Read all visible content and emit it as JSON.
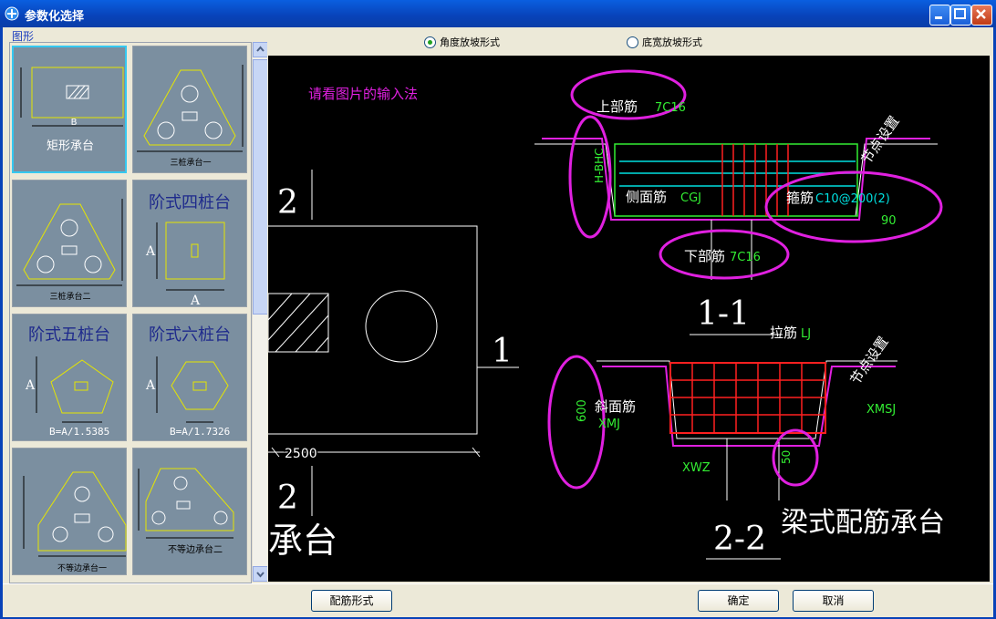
{
  "window": {
    "title": "参数化选择"
  },
  "left": {
    "group_label": "图形",
    "thumbnails": [
      {
        "label": "矩形承台",
        "dim": "B"
      },
      {
        "label": "三桩承台一"
      },
      {
        "label": "三桩承台二"
      },
      {
        "label": "阶式四桩台",
        "dim_a": "A",
        "dim_b": "A"
      },
      {
        "label": "阶式五桩台",
        "dim_a": "A",
        "formula": "B=A/1.5385"
      },
      {
        "label": "阶式六桩台",
        "dim_a": "A",
        "formula": "B=A/1.7326"
      },
      {
        "label": "不等边承台一"
      },
      {
        "label": "不等边承台二"
      }
    ]
  },
  "options": {
    "angle": "角度放坡形式",
    "width": "底宽放坡形式",
    "selected": "angle"
  },
  "drawing": {
    "hint": "请看图片的输入法",
    "sec2_top": "2",
    "sec1": "1",
    "dim2500": "2500",
    "sec2_bottom": "2",
    "partial_title": "承台",
    "upper_label": "上部筋",
    "upper_value": "7C16",
    "hbhc": "H-BHC",
    "side_label": "侧面筋",
    "side_value": "CGJ",
    "stirrup_label": "箍筋",
    "stirrup_value": "C10@200(2)",
    "angle90": "90",
    "lower_label": "下部筋",
    "lower_value": "7C16",
    "node_setting": "节点设置",
    "section11": "1-1",
    "tie_label": "拉筋",
    "tie_value": "LJ",
    "node_setting2": "节点设置",
    "dim600": "600",
    "slope_label": "斜面筋",
    "slope_value": "XMJ",
    "xmsj": "XMSJ",
    "xwz": "XWZ",
    "dim50": "50",
    "section22": "2-2",
    "main_title": "梁式配筋承台"
  },
  "buttons": {
    "rebar": "配筋形式",
    "ok": "确定",
    "cancel": "取消"
  },
  "colors": {
    "titlebar": "#0a4fd0",
    "thumb_bg": "#7b8fa0",
    "selected_border": "#35c8f0",
    "magenta": "#e020e0",
    "green": "#33ee33",
    "cyan": "#00e0e0",
    "red": "#ff2020"
  }
}
